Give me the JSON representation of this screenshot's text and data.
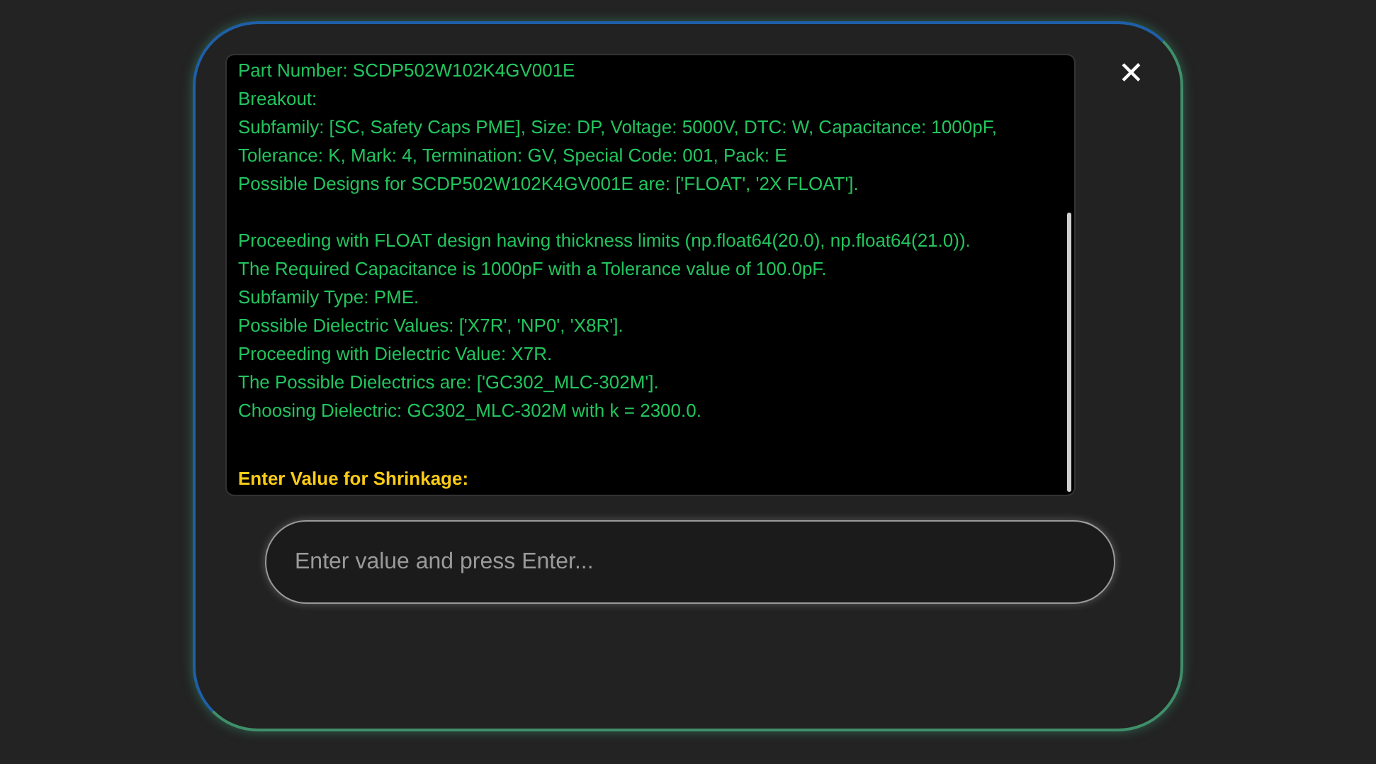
{
  "console": {
    "lines": [
      {
        "kind": "output",
        "text": "Part Number: SCDP502W102K4GV001E"
      },
      {
        "kind": "output",
        "text": "Breakout:"
      },
      {
        "kind": "output",
        "text": "Subfamily: [SC, Safety Caps PME], Size: DP, Voltage: 5000V, DTC: W, Capacitance: 1000pF,"
      },
      {
        "kind": "output",
        "text": "Tolerance: K, Mark: 4, Termination: GV, Special Code: 001, Pack: E"
      },
      {
        "kind": "output",
        "text": "Possible Designs for SCDP502W102K4GV001E are: ['FLOAT', '2X FLOAT']."
      },
      {
        "kind": "blank"
      },
      {
        "kind": "output",
        "text": "Proceeding with FLOAT design having thickness limits (np.float64(20.0), np.float64(21.0))."
      },
      {
        "kind": "output",
        "text": "The Required Capacitance is 1000pF with a Tolerance value of 100.0pF."
      },
      {
        "kind": "output",
        "text": "Subfamily Type: PME."
      },
      {
        "kind": "output",
        "text": "Possible Dielectric Values: ['X7R', 'NP0', 'X8R']."
      },
      {
        "kind": "output",
        "text": "Proceeding with Dielectric Value: X7R."
      },
      {
        "kind": "output",
        "text": "The Possible Dielectrics are: ['GC302_MLC-302M']."
      },
      {
        "kind": "output",
        "text": "Choosing Dielectric: GC302_MLC-302M with k = 2300.0."
      },
      {
        "kind": "blank"
      },
      {
        "kind": "prompt",
        "text": "Enter Value for Shrinkage:"
      }
    ]
  },
  "close_button": {
    "label": "✕"
  },
  "input": {
    "placeholder": "Enter value and press Enter..."
  }
}
